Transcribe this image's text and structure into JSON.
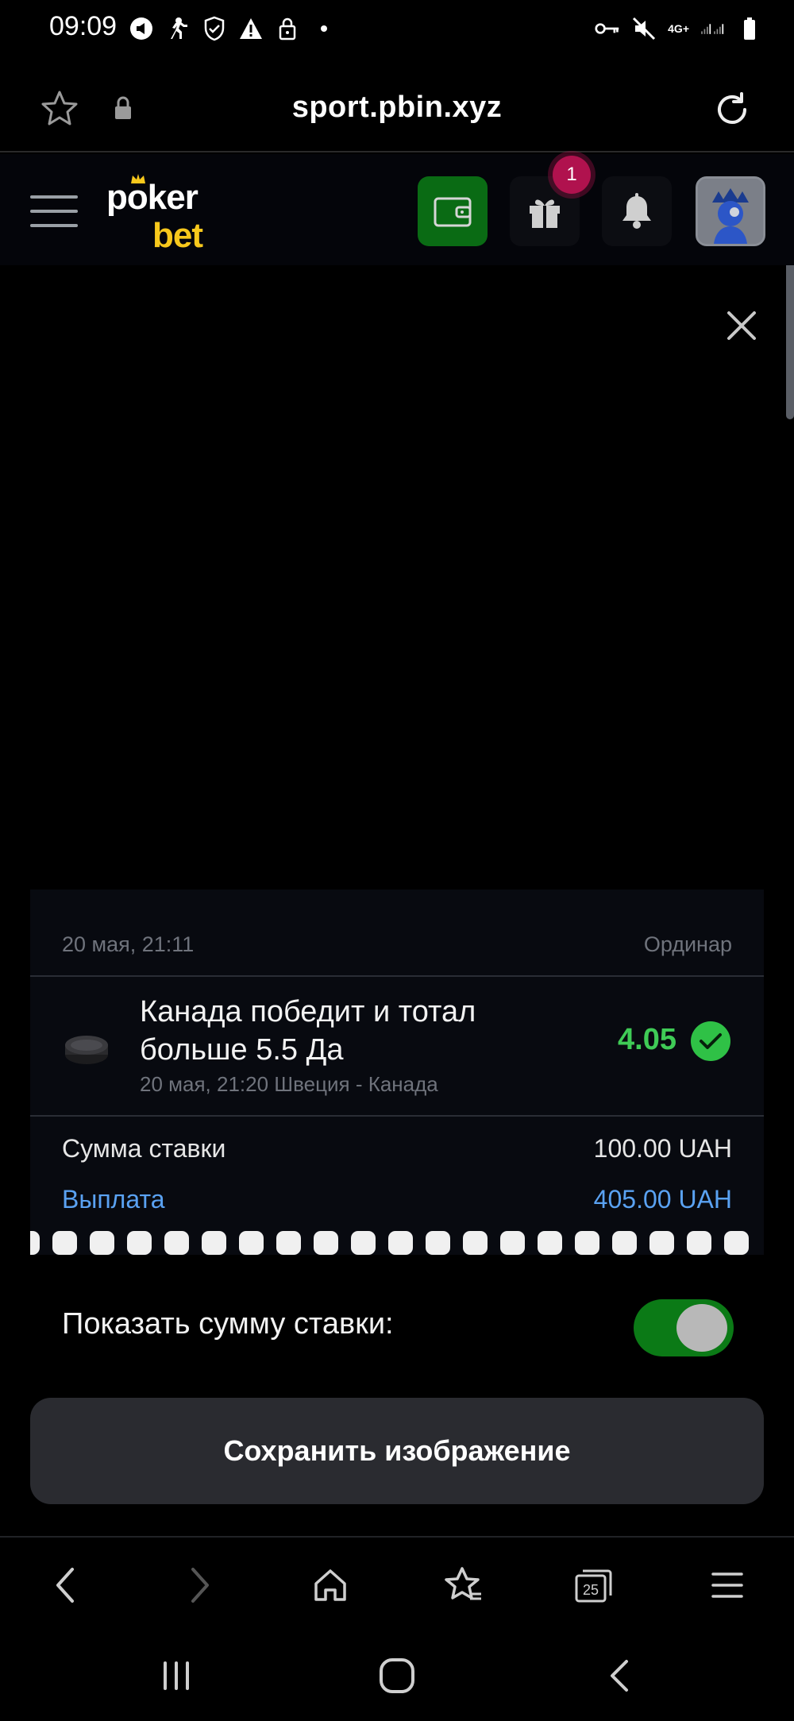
{
  "status_bar": {
    "time": "09:09",
    "network": "4G+",
    "icons_left": [
      "megaphone-icon",
      "running-icon",
      "shield-check-icon",
      "warning-icon",
      "lock-icon",
      "dot-icon"
    ],
    "icons_right": [
      "key-icon",
      "mute-icon",
      "signal-icon",
      "battery-icon"
    ]
  },
  "browser": {
    "url": "sport.pbin.xyz",
    "tabs_count": "25"
  },
  "header": {
    "logo_word1": "pker",
    "logo_word1_o": "o",
    "logo_word2": "bet",
    "gift_badge_count": "1",
    "colors": {
      "accent_yellow": "#f7c81c",
      "wallet_green": "#0a6b14",
      "badge": "#b0124e"
    }
  },
  "bet": {
    "date": "20 мая, 21:11",
    "type": "Ординар",
    "event_title": "Канада победит и тотал больше 5.5 Да",
    "event_sub": "20 мая, 21:20 Швеция - Канада",
    "odds": "4.05",
    "status": "won",
    "stake_label": "Сумма ставки",
    "stake_value": "100.00 UAH",
    "payout_label": "Выплата",
    "payout_value": "405.00 UAH",
    "sport_icon": "hockey-puck-icon"
  },
  "toggle": {
    "label": "Показать сумму ставки:",
    "on": true
  },
  "actions": {
    "save_label": "Сохранить изображение"
  }
}
